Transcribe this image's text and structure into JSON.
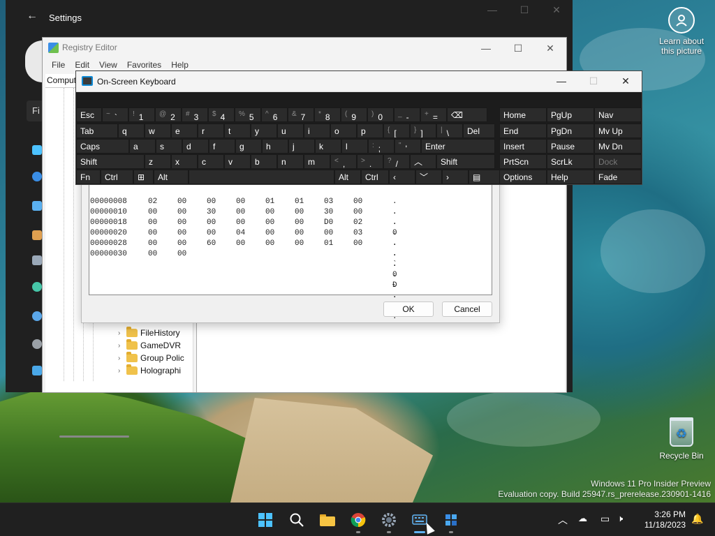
{
  "desktop": {
    "learn_label": "Learn about this picture",
    "recycle_label": "Recycle Bin",
    "watermark_line1": "Windows 11 Pro Insider Preview",
    "watermark_line2": "Evaluation copy. Build 25947.rs_prerelease.230901-1416"
  },
  "settings": {
    "title": "Settings",
    "search_partial": "Fi"
  },
  "regedit": {
    "title": "Registry Editor",
    "menu": [
      "File",
      "Edit",
      "View",
      "Favorites",
      "Help"
    ],
    "address_partial": "Comput",
    "tree_items": [
      "FileHistory",
      "GameDVR",
      "Group Polic",
      "Holographi"
    ]
  },
  "dialog": {
    "ok_label": "OK",
    "cancel_label": "Cancel",
    "hex_rows": [
      {
        "addr": "00000008",
        "bytes": [
          "02",
          "00",
          "00",
          "00",
          "01",
          "01",
          "03",
          "00"
        ],
        "ascii": ". . . . . . . ."
      },
      {
        "addr": "00000010",
        "bytes": [
          "00",
          "00",
          "30",
          "00",
          "00",
          "00",
          "30",
          "00"
        ],
        "ascii": ". . 0 . . . 0 ."
      },
      {
        "addr": "00000018",
        "bytes": [
          "00",
          "00",
          "00",
          "00",
          "00",
          "00",
          "D0",
          "02"
        ],
        "ascii": ". . . . . . Ð ."
      },
      {
        "addr": "00000020",
        "bytes": [
          "00",
          "00",
          "00",
          "04",
          "00",
          "00",
          "00",
          "03"
        ],
        "ascii": ". . . . . . . ."
      },
      {
        "addr": "00000028",
        "bytes": [
          "00",
          "00",
          "60",
          "00",
          "00",
          "00",
          "01",
          "00"
        ],
        "ascii": ". . ` . . . . ."
      },
      {
        "addr": "00000030",
        "bytes": [
          "00",
          "00"
        ],
        "ascii": ". ."
      }
    ]
  },
  "osk": {
    "title": "On-Screen Keyboard",
    "rows": [
      [
        {
          "id": "esc",
          "main": "Esc"
        },
        {
          "id": "tilde",
          "shift": "~",
          "main": "`"
        },
        {
          "id": "1",
          "shift": "!",
          "main": "1"
        },
        {
          "id": "2",
          "shift": "@",
          "main": "2"
        },
        {
          "id": "3",
          "shift": "#",
          "main": "3"
        },
        {
          "id": "4",
          "shift": "$",
          "main": "4"
        },
        {
          "id": "5",
          "shift": "%",
          "main": "5"
        },
        {
          "id": "6",
          "shift": "^",
          "main": "6"
        },
        {
          "id": "7",
          "shift": "&",
          "main": "7"
        },
        {
          "id": "8",
          "shift": "*",
          "main": "8"
        },
        {
          "id": "9",
          "shift": "(",
          "main": "9"
        },
        {
          "id": "0",
          "shift": ")",
          "main": "0"
        },
        {
          "id": "minus",
          "shift": "_",
          "main": "-"
        },
        {
          "id": "equals",
          "shift": "+",
          "main": "="
        },
        {
          "id": "backspace",
          "main": "⌫"
        }
      ],
      [
        {
          "id": "tab",
          "main": "Tab"
        },
        {
          "id": "q",
          "main": "q"
        },
        {
          "id": "w",
          "main": "w"
        },
        {
          "id": "e",
          "main": "e"
        },
        {
          "id": "r",
          "main": "r"
        },
        {
          "id": "t",
          "main": "t"
        },
        {
          "id": "y",
          "main": "y"
        },
        {
          "id": "u",
          "main": "u"
        },
        {
          "id": "i",
          "main": "i"
        },
        {
          "id": "o",
          "main": "o"
        },
        {
          "id": "p",
          "main": "p"
        },
        {
          "id": "lbracket",
          "shift": "{",
          "main": "["
        },
        {
          "id": "rbracket",
          "shift": "}",
          "main": "]"
        },
        {
          "id": "backslash",
          "shift": "|",
          "main": "\\"
        },
        {
          "id": "del",
          "main": "Del"
        }
      ],
      [
        {
          "id": "caps",
          "main": "Caps"
        },
        {
          "id": "a",
          "main": "a"
        },
        {
          "id": "s",
          "main": "s"
        },
        {
          "id": "d",
          "main": "d"
        },
        {
          "id": "f",
          "main": "f"
        },
        {
          "id": "g",
          "main": "g"
        },
        {
          "id": "h",
          "main": "h"
        },
        {
          "id": "j",
          "main": "j"
        },
        {
          "id": "k",
          "main": "k"
        },
        {
          "id": "l",
          "main": "l"
        },
        {
          "id": "semicolon",
          "shift": ":",
          "main": ";"
        },
        {
          "id": "quote",
          "shift": "\"",
          "main": "'"
        },
        {
          "id": "enter",
          "main": "Enter"
        }
      ],
      [
        {
          "id": "lshift",
          "main": "Shift"
        },
        {
          "id": "z",
          "main": "z"
        },
        {
          "id": "x",
          "main": "x"
        },
        {
          "id": "c",
          "main": "c"
        },
        {
          "id": "v",
          "main": "v"
        },
        {
          "id": "b",
          "main": "b"
        },
        {
          "id": "n",
          "main": "n"
        },
        {
          "id": "m",
          "main": "m"
        },
        {
          "id": "comma",
          "shift": "<",
          "main": ","
        },
        {
          "id": "period",
          "shift": ">",
          "main": "."
        },
        {
          "id": "slash",
          "shift": "?",
          "main": "/"
        },
        {
          "id": "up",
          "main": "︿"
        },
        {
          "id": "rshift",
          "main": "Shift"
        }
      ],
      [
        {
          "id": "fn",
          "main": "Fn"
        },
        {
          "id": "lctrl",
          "main": "Ctrl"
        },
        {
          "id": "win",
          "main": "⊞"
        },
        {
          "id": "lalt",
          "main": "Alt"
        },
        {
          "id": "space",
          "main": ""
        },
        {
          "id": "ralt",
          "main": "Alt"
        },
        {
          "id": "rctrl",
          "main": "Ctrl"
        },
        {
          "id": "left",
          "main": "‹"
        },
        {
          "id": "down",
          "main": "﹀"
        },
        {
          "id": "right",
          "main": "›"
        },
        {
          "id": "menu",
          "main": "▤"
        }
      ]
    ],
    "nav_rows": [
      [
        "Home",
        "PgUp",
        "Nav"
      ],
      [
        "End",
        "PgDn",
        "Mv Up"
      ],
      [
        "Insert",
        "Pause",
        "Mv Dn"
      ],
      [
        "PrtScn",
        "ScrLk",
        "Dock"
      ],
      [
        "Options",
        "Help",
        "Fade"
      ]
    ]
  },
  "taskbar": {
    "time": "3:26 PM",
    "date": "11/18/2023"
  },
  "colors": {
    "accent": "#5fb2f2",
    "osk_bg": "#1c1c1c",
    "osk_key": "#2b2b2b",
    "taskbar_bg": "#202020"
  }
}
